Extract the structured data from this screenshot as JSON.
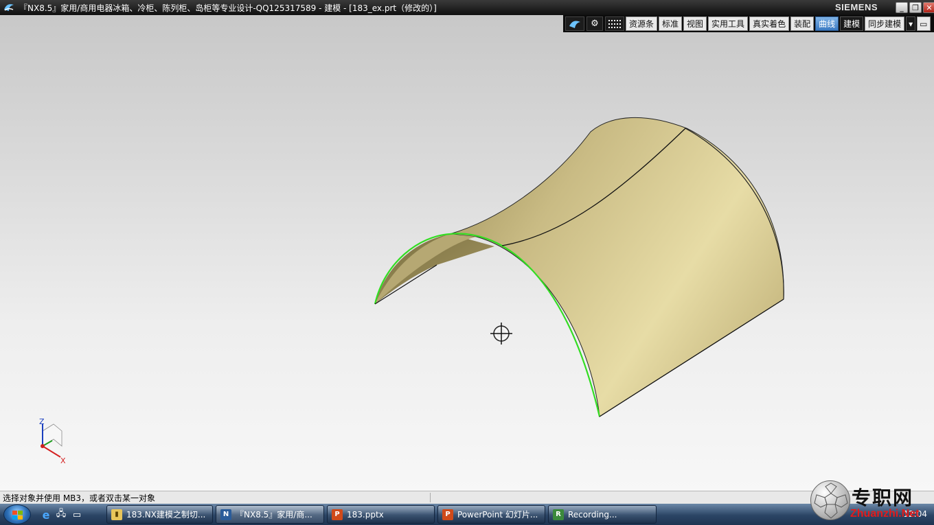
{
  "window": {
    "title": "『NX8.5』家用/商用电器冰箱、冷柜、陈列柜、岛柜等专业设计-QQ125317589 - 建模 - [183_ex.prt（修改的）]",
    "brand": "SIEMENS",
    "minimize": "_",
    "restore": "❐",
    "close": "✕"
  },
  "ribbon": {
    "tabs": [
      {
        "label": "资源条"
      },
      {
        "label": "标准"
      },
      {
        "label": "视图"
      },
      {
        "label": "实用工具"
      },
      {
        "label": "真实着色"
      },
      {
        "label": "装配"
      },
      {
        "label": "曲线"
      },
      {
        "label": "建模"
      },
      {
        "label": "同步建模"
      }
    ],
    "active_tab": "曲线",
    "more_glyph": "▾",
    "restore_glyph": "▭"
  },
  "viewport": {
    "triad": {
      "z": "Z",
      "x": "X"
    },
    "colors": {
      "surface": "#c9bb84",
      "highlight_edge": "#33dd22",
      "edge": "#111111"
    }
  },
  "status": {
    "prompt": "选择对象并使用 MB3，或者双击某一对象"
  },
  "taskbar": {
    "items": [
      {
        "label": "183.NX建模之制切..."
      },
      {
        "label": "『NX8.5』家用/商..."
      },
      {
        "label": "183.pptx"
      },
      {
        "label": "PowerPoint 幻灯片..."
      },
      {
        "label": "Recording..."
      }
    ],
    "clock": "12:04"
  },
  "watermark": {
    "text_cn": "专职网",
    "text_en": "Zhuanzhi.Net"
  }
}
